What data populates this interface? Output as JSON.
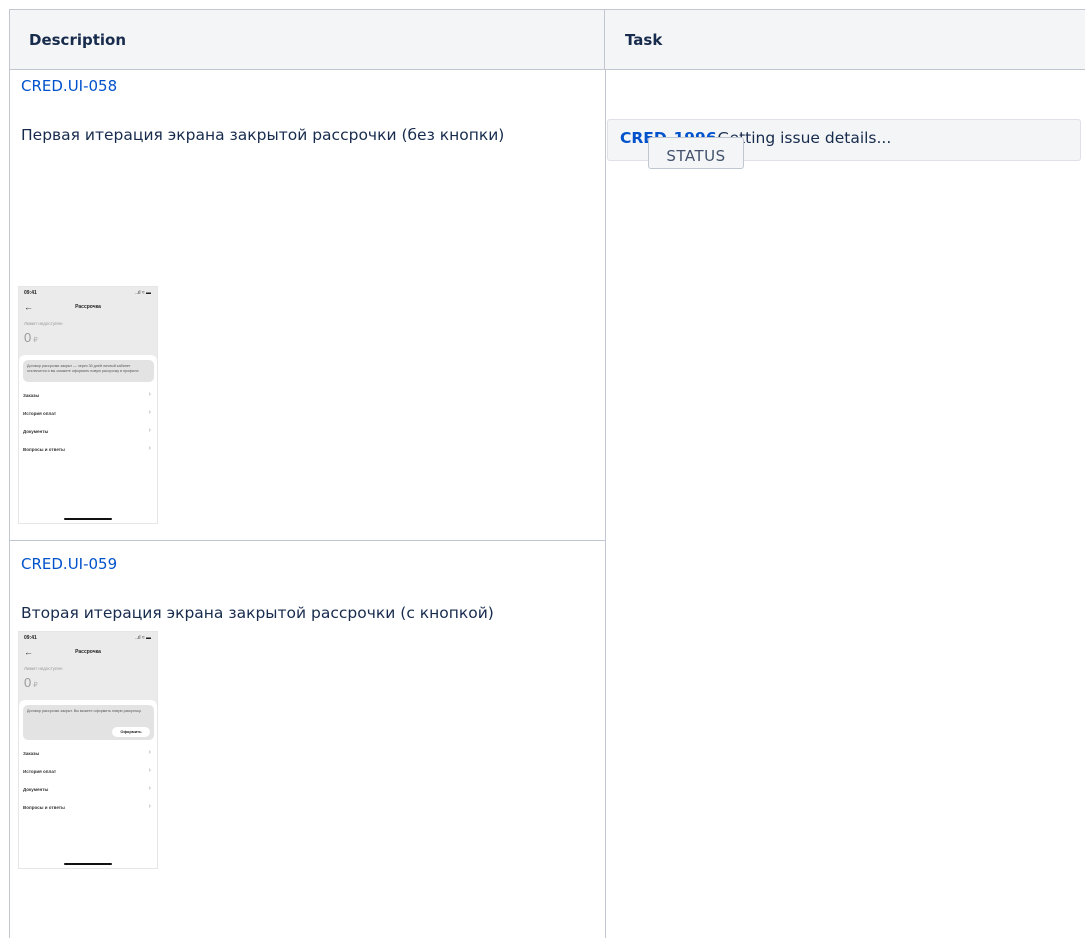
{
  "table": {
    "headers": {
      "description": "Description",
      "task": "Task"
    }
  },
  "rows": [
    {
      "link": "CRED.UI-058",
      "description": "Первая итерация экрана закрытой рассрочки (без кнопки)",
      "phone": {
        "time": "09:41",
        "status_icons": "..ıl ≈ ▬",
        "title": "Рассрочка",
        "limit_label": "Лимит недоступен",
        "amount": "0",
        "currency": "₽",
        "note": "Договор рассрочки закрыт — через 30 дней личный кабинет отключится и вы сможете оформить новую рассрочку в профиле.",
        "menu": [
          "Заказы",
          "История оплат",
          "Документы",
          "Вопросы и ответы"
        ]
      }
    },
    {
      "link": "CRED.UI-059",
      "description": "Вторая итерация экрана закрытой рассрочки (с кнопкой)",
      "phone": {
        "time": "09:41",
        "status_icons": "..ıl ≈ ▬",
        "title": "Рассрочка",
        "limit_label": "Лимит недоступен",
        "amount": "0",
        "currency": "₽",
        "note": "Договор рассрочки закрыт. Вы можете оформить новую рассрочку.",
        "button": "Оформить",
        "menu": [
          "Заказы",
          "История оплат",
          "Документы",
          "Вопросы и ответы"
        ]
      }
    }
  ],
  "jira": {
    "key": "CRED-1996",
    "summary": " - Getting issue details...",
    "status": "STATUS"
  },
  "colors": {
    "link": "#0052cc",
    "header_bg": "#f4f5f7",
    "border": "#c1c7d0"
  }
}
